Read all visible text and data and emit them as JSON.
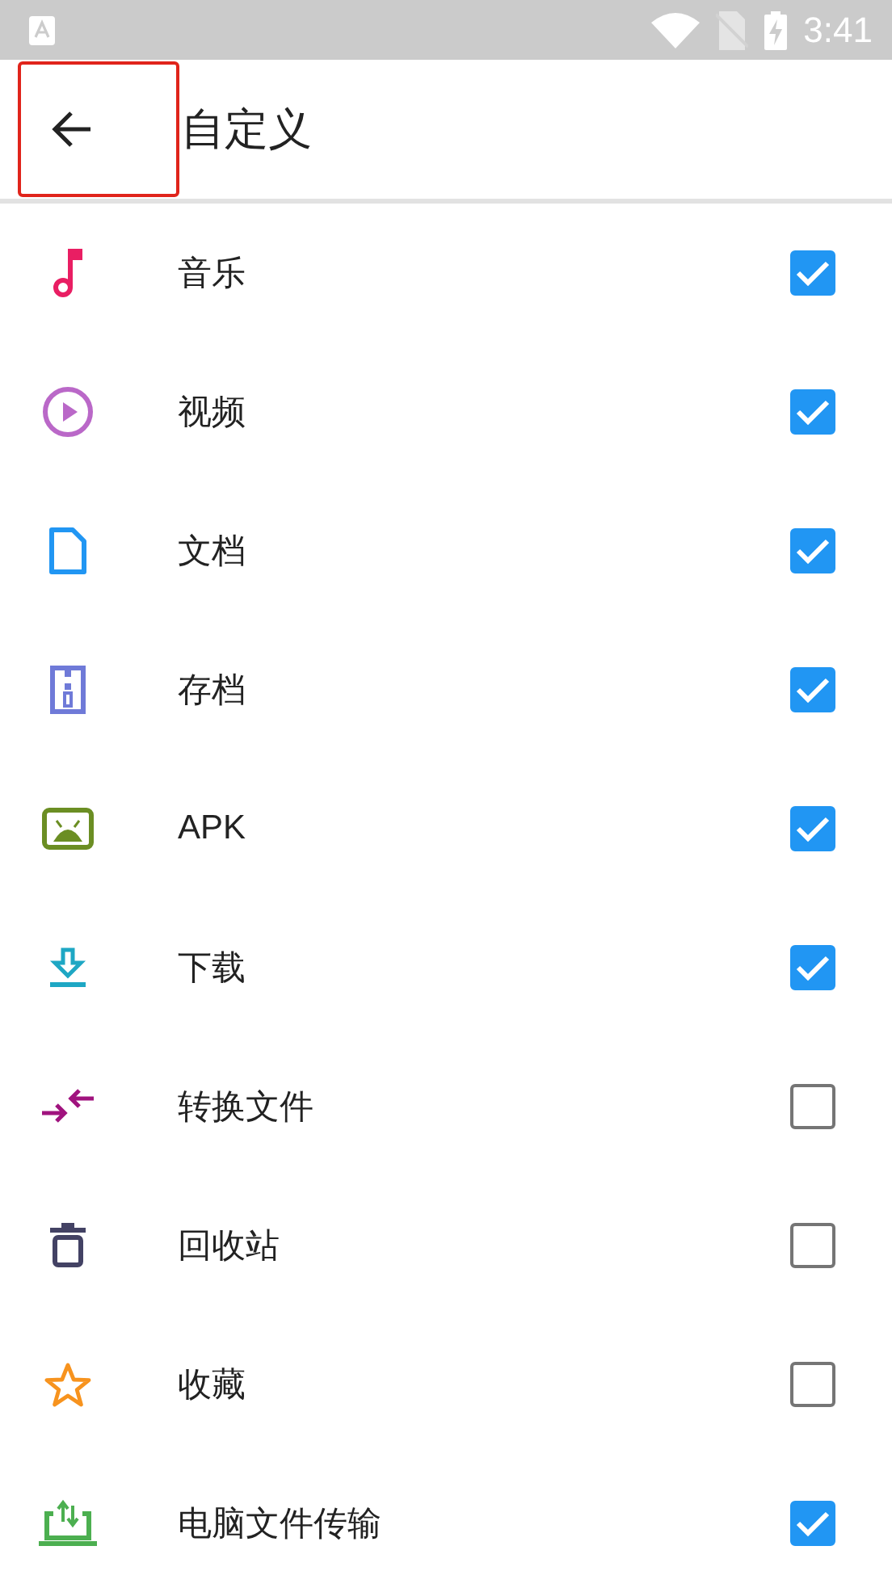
{
  "status_bar": {
    "time": "3:41"
  },
  "app_bar": {
    "title": "自定义",
    "back_button": {
      "highlighted": true
    }
  },
  "items": [
    {
      "label": "音乐",
      "kind": "music",
      "color": "#e91e63",
      "checked": true
    },
    {
      "label": "视频",
      "kind": "play",
      "color": "#ba68c8",
      "checked": true
    },
    {
      "label": "文档",
      "kind": "document",
      "color": "#2196f3",
      "checked": true
    },
    {
      "label": "存档",
      "kind": "archive",
      "color": "#6f7ad8",
      "checked": true
    },
    {
      "label": "APK",
      "kind": "android",
      "color": "#6b8e23",
      "checked": true
    },
    {
      "label": "下载",
      "kind": "download",
      "color": "#1ea7c4",
      "checked": true
    },
    {
      "label": "转换文件",
      "kind": "convert",
      "color": "#a0137e",
      "checked": false
    },
    {
      "label": "回收站",
      "kind": "trash",
      "color": "#434264",
      "checked": false
    },
    {
      "label": "收藏",
      "kind": "star",
      "color": "#f7931e",
      "checked": false
    },
    {
      "label": "电脑文件传输",
      "kind": "transfer",
      "color": "#4caf50",
      "checked": true
    }
  ]
}
